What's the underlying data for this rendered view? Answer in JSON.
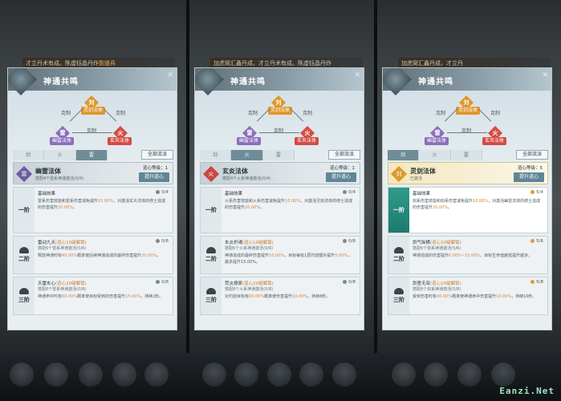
{
  "panel_title": "神通共鸣",
  "ring": {
    "top": {
      "char": "刘",
      "label": "灵剑法体"
    },
    "left": {
      "char": "雷",
      "label": "幽雷法体"
    },
    "right": {
      "char": "火",
      "label": "玄炎法体"
    },
    "left_txt": "克制",
    "right_txt": "克制",
    "mid_txt": "克制"
  },
  "all_button": "全部流派",
  "tabs": [
    "剑",
    "火",
    "雷"
  ],
  "up_button": "提升道心",
  "watermark": "Eanzi.Net",
  "panels": [
    {
      "topbar": "才立丹术有成。陈虚钰晶丹炸",
      "topbar_hl": "到道兵",
      "active_tab": 2,
      "body": {
        "char": "雷",
        "name": "幽雷法体",
        "sub": "搭配4个雷系神通激活(0/4)",
        "level": "道心等级：1"
      },
      "tiers": [
        {
          "name": "一阶",
          "head": "基础效果",
          "req": "",
          "sub": "",
          "count": "0/4",
          "desc_a": "雷系伤害技能和雷系伤害减免提升",
          "desc_b": "10.00%",
          "desc_c": "，对激活玄炎法体的修士造成的伤害提升",
          "desc_d": "20.00%",
          "desc_e": "。"
        },
        {
          "name": "二阶",
          "head": "雷动九天",
          "req": "(道心10级解锁)",
          "sub": "搭配6个雷系神通激活(0/6)",
          "count": "0/6",
          "desc_a": "释放神通时有",
          "desc_b": "40.00%",
          "desc_c": "概率使后续神通造成的最终伤害提升",
          "desc_d": "20.00%",
          "desc_e": "。"
        },
        {
          "name": "三阶",
          "head": "天雷玄心",
          "req": "(道心20级解锁)",
          "sub": "搭配8个雷系神通激活(0/8)",
          "count": "0/8",
          "desc_a": "神通命中时有",
          "desc_b": "60.00%",
          "desc_c": "概率使目标受到的伤害提升",
          "desc_d": "15.00%",
          "desc_e": "，持续2秒。"
        }
      ]
    },
    {
      "topbar": "加虎窝汇鑫丹成，才立丹术有成。陈虚钰晶丹炸",
      "topbar_hl": "",
      "active_tab": 1,
      "body": {
        "char": "火",
        "name": "玄炎法体",
        "sub": "搭配4个火系神通激活(0/4)",
        "level": "道心等级：1"
      },
      "tiers": [
        {
          "name": "一阶",
          "head": "基础效果",
          "req": "",
          "sub": "",
          "count": "0/4",
          "desc_a": "火系伤害技能和火系伤害减免提升",
          "desc_b": "10.00%",
          "desc_c": "，对激活灵剑法体的修士造成的伤害提升",
          "desc_d": "20.00%",
          "desc_e": "。"
        },
        {
          "name": "二阶",
          "head": "玄炎炽魂",
          "req": "(道心10级解锁)",
          "sub": "搭配6个火系神通激活(0/6)",
          "count": "0/6",
          "desc_a": "神通造成的最终伤害提升",
          "desc_b": "10.00%",
          "desc_c": "，目标每有1层灼烧额外提升",
          "desc_d": "5.00%",
          "desc_e": "，最多提升15.00%。"
        },
        {
          "name": "三阶",
          "head": "焚炎燎原",
          "req": "(道心20级解锁)",
          "sub": "搭配8个火系神通激活(0/8)",
          "count": "0/8",
          "desc_a": "对灼烧目标有",
          "desc_b": "60.00%",
          "desc_c": "概率使伤害提升",
          "desc_d": "10.00%",
          "desc_e": "，持续8秒。"
        }
      ]
    },
    {
      "topbar": "加虎窝汇鑫丹成，才立丹",
      "topbar_hl": "",
      "active_tab": 0,
      "body": {
        "char": "刘",
        "name": "灵剑法体",
        "sub": "已激活",
        "level": "道心等级：5"
      },
      "tiers": [
        {
          "name": "一阶",
          "head": "基础效果",
          "req": "",
          "sub": "",
          "count": "5/4",
          "desc_a": "剑系伤害技能和剑系伤害减免提升",
          "desc_b": "10.00%",
          "desc_c": "，对激活幽雷法体的修士造成的伤害提升",
          "desc_d": "20.00%",
          "desc_e": "。"
        },
        {
          "name": "二阶",
          "head": "剑气纵横",
          "req": "(道心10级解锁)",
          "sub": "搭配6个剑系神通激活(5/6)",
          "count": "5/6",
          "desc_a": "神通造成的伤害提升",
          "desc_b": "6.00%~15.00%",
          "desc_c": "，目标生命值越低提升越多。",
          "desc_d": "",
          "desc_e": ""
        },
        {
          "name": "三阶",
          "head": "剑意无双",
          "req": "(道心20级解锁)",
          "sub": "搭配8个剑系神通激活(5/8)",
          "count": "5/8",
          "desc_a": "受到伤害时有",
          "desc_b": "40.00%",
          "desc_c": "概率使神通命中伤害提升",
          "desc_d": "10.00%",
          "desc_e": "，持续10秒。"
        }
      ]
    }
  ]
}
